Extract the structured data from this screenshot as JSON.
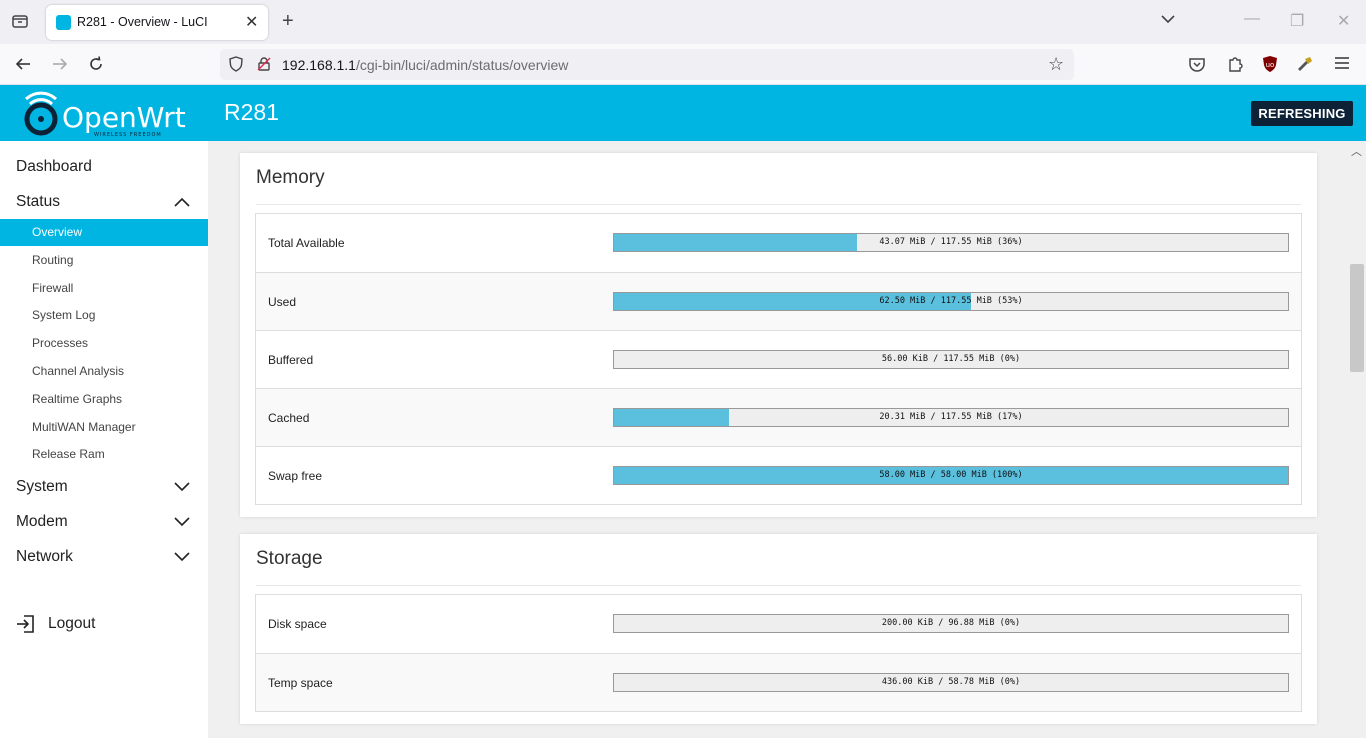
{
  "browser": {
    "tab_title": "R281 - Overview - LuCI",
    "url_host": "192.168.1.1",
    "url_path": "/cgi-bin/luci/admin/status/overview"
  },
  "header": {
    "logo_text": "OpenWrt",
    "logo_tagline": "WIRELESS FREEDOM",
    "hostname": "R281",
    "status_badge": "REFRESHING",
    "accent_color": "#00b5e2"
  },
  "sidebar": {
    "dashboard": "Dashboard",
    "status": "Status",
    "status_items": [
      {
        "label": "Overview",
        "active": true
      },
      {
        "label": "Routing"
      },
      {
        "label": "Firewall"
      },
      {
        "label": "System Log"
      },
      {
        "label": "Processes"
      },
      {
        "label": "Channel Analysis"
      },
      {
        "label": "Realtime Graphs"
      },
      {
        "label": "MultiWAN Manager"
      },
      {
        "label": "Release Ram"
      }
    ],
    "system": "System",
    "modem": "Modem",
    "network": "Network",
    "logout": "Logout"
  },
  "memory": {
    "title": "Memory",
    "rows": [
      {
        "label": "Total Available",
        "value": "43.07 MiB / 117.55 MiB (36%)",
        "percent": 36
      },
      {
        "label": "Used",
        "value": "62.50 MiB / 117.55 MiB (53%)",
        "percent": 53
      },
      {
        "label": "Buffered",
        "value": "56.00 KiB / 117.55 MiB (0%)",
        "percent": 0
      },
      {
        "label": "Cached",
        "value": "20.31 MiB / 117.55 MiB (17%)",
        "percent": 17
      },
      {
        "label": "Swap free",
        "value": "58.00 MiB / 58.00 MiB (100%)",
        "percent": 100
      }
    ]
  },
  "storage": {
    "title": "Storage",
    "rows": [
      {
        "label": "Disk space",
        "value": "200.00 KiB / 96.88 MiB (0%)",
        "percent": 0
      },
      {
        "label": "Temp space",
        "value": "436.00 KiB / 58.78 MiB (0%)",
        "percent": 0
      }
    ]
  }
}
